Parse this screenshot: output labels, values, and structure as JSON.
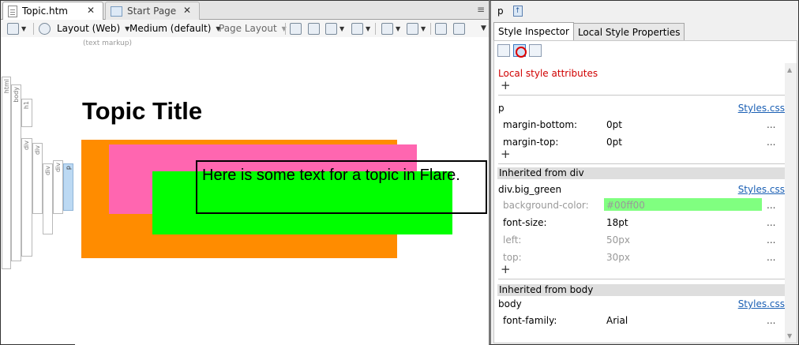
{
  "editor": {
    "tabs": [
      {
        "label": "Topic.htm",
        "close": "✕",
        "active": true
      },
      {
        "label": "Start Page",
        "close": "✕",
        "active": false
      }
    ],
    "tab_menu": "≡",
    "toolbar": {
      "layout_web": "Layout (Web)",
      "medium": "Medium (default)",
      "page_layout": "Page Layout"
    },
    "markup_label": "(text markup)",
    "structure_bar": [
      "html",
      "body",
      "h1",
      "div",
      "div",
      "div",
      "div",
      "p"
    ],
    "topic_title": "Topic Title",
    "paragraph": "Here is some text for a topic in Flare."
  },
  "inspector": {
    "selected_tag": "p",
    "tabs": [
      {
        "label": "Style Inspector",
        "active": true
      },
      {
        "label": "Local Style Properties",
        "active": false
      }
    ],
    "local_title": "Local style attributes",
    "plus": "+",
    "more": "...",
    "sections": {
      "p": {
        "selector": "p",
        "source": "Styles.css",
        "props": [
          {
            "name": "margin-bottom:",
            "value": "0pt"
          },
          {
            "name": "margin-top:",
            "value": "0pt"
          }
        ]
      },
      "div": {
        "header": "Inherited from div",
        "selector": "div.big_green",
        "source": "Styles.css",
        "props": [
          {
            "name": "background-color:",
            "value": "#00ff00",
            "dim": true
          },
          {
            "name": "font-size:",
            "value": "18pt",
            "dim": false
          },
          {
            "name": "left:",
            "value": "50px",
            "dim": true
          },
          {
            "name": "top:",
            "value": "30px",
            "dim": true
          }
        ]
      },
      "body": {
        "header": "Inherited from body",
        "selector": "body",
        "source": "Styles.css",
        "props": [
          {
            "name": "font-family:",
            "value": "Arial"
          }
        ]
      }
    }
  },
  "colors": {
    "orange_box": "#ff8c00",
    "pink_box": "#ff66b0",
    "green_box": "#00ff00",
    "swatch": "#80ff80",
    "local_title": "#d00000",
    "link": "#1a5fb4"
  }
}
